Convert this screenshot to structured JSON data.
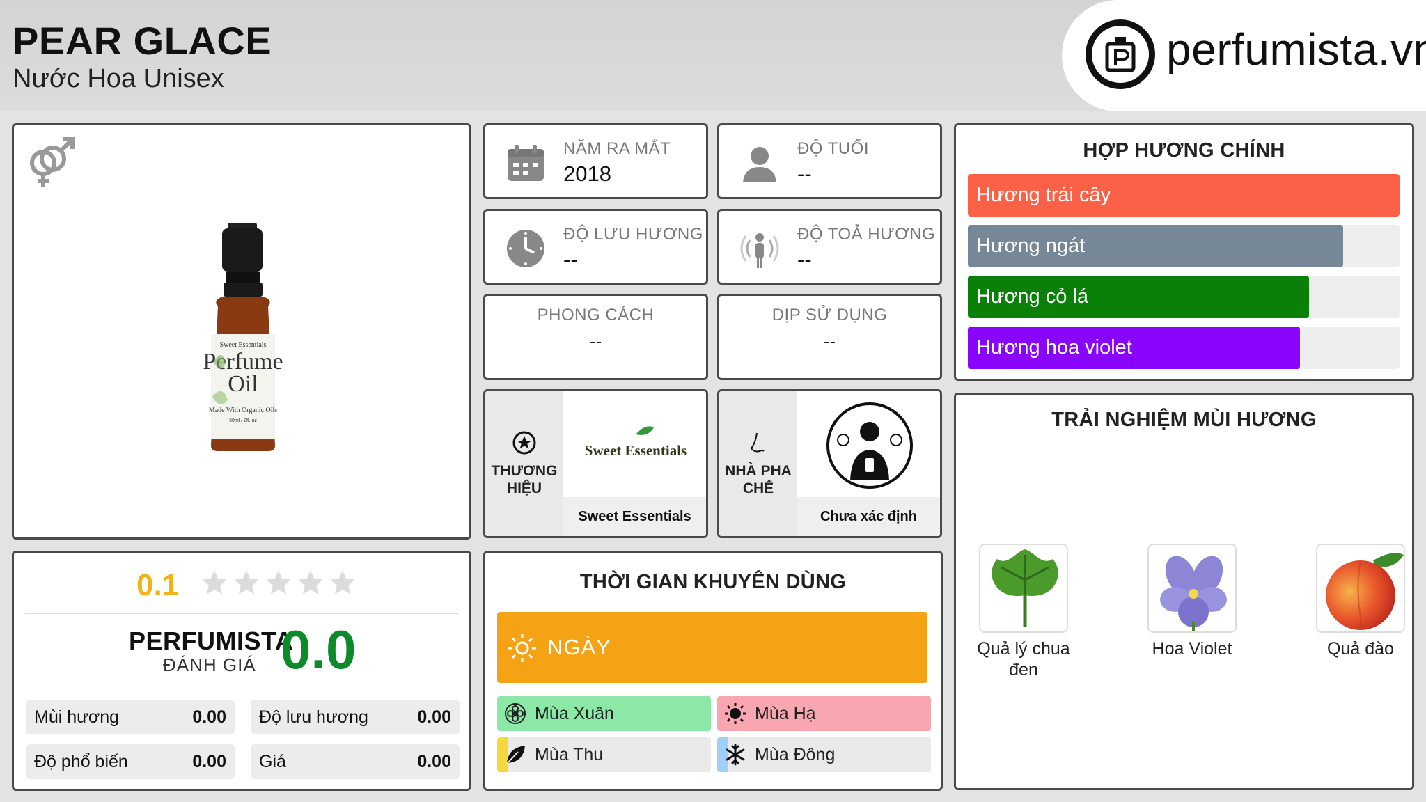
{
  "header": {
    "title": "PEAR GLACE",
    "subtitle": "Nước Hoa Unisex",
    "logo_text": "perfumista.vn"
  },
  "product": {
    "gender_icon": "unisex-gender-icon",
    "bottle_brand_text": "Sweet Essentials",
    "bottle_product_line1": "Perfume",
    "bottle_product_line2": "Oil",
    "bottle_note": "Made With Organic Oils",
    "bottle_size": "60ml / 2fl. oz"
  },
  "stats": {
    "release_year": {
      "label": "NĂM RA MẮT",
      "value": "2018",
      "icon": "calendar-icon"
    },
    "age": {
      "label": "ĐỘ TUỔI",
      "value": "--",
      "icon": "person-icon"
    },
    "longevity": {
      "label": "ĐỘ LƯU HƯƠNG",
      "value": "--",
      "icon": "clock-icon"
    },
    "sillage": {
      "label": "ĐỘ TOẢ HƯƠNG",
      "value": "--",
      "icon": "sillage-icon"
    },
    "style": {
      "label": "PHONG CÁCH",
      "value": "--"
    },
    "occasion": {
      "label": "DỊP SỬ DỤNG",
      "value": "--"
    }
  },
  "brand": {
    "label": "THƯƠNG HIỆU",
    "logo_text": "Sweet Essentials",
    "name": "Sweet Essentials",
    "icon": "star-circle-icon"
  },
  "perfumer": {
    "label": "NHÀ PHA CHẾ",
    "name": "Chưa xác định",
    "icon": "nose-icon"
  },
  "accords": {
    "title": "HỢP HƯƠNG CHÍNH",
    "items": [
      {
        "label": "Hương trái cây",
        "level": 1.0,
        "color": "#fa6147"
      },
      {
        "label": "Hương ngát",
        "level": 0.87,
        "color": "#768898"
      },
      {
        "label": "Hương cỏ lá",
        "level": 0.79,
        "color": "#0a8008"
      },
      {
        "label": "Hương hoa violet",
        "level": 0.77,
        "color": "#8a05fb"
      }
    ]
  },
  "notes": {
    "title": "TRẢI NGHIỆM MÙI HƯƠNG",
    "items": [
      {
        "label": "Quả lý chua đen",
        "icon": "blackcurrant-leaf-image"
      },
      {
        "label": "Hoa Violet",
        "icon": "violet-flower-image"
      },
      {
        "label": "Quả đào",
        "icon": "peach-image"
      }
    ]
  },
  "rating": {
    "value": "0.1",
    "stars_filled": 0.02,
    "stars_total": 5,
    "perfumista_label": "PERFUMISTA",
    "perfumista_sub": "ĐÁNH GIÁ",
    "perfumista_score": "0.0",
    "metrics": [
      {
        "label": "Mùi hương",
        "value": "0.00"
      },
      {
        "label": "Độ lưu hương",
        "value": "0.00"
      },
      {
        "label": "Độ phổ biến",
        "value": "0.00"
      },
      {
        "label": "Giá",
        "value": "0.00"
      }
    ]
  },
  "recommended_time": {
    "title": "THỜI GIAN KHUYÊN DÙNG",
    "day": {
      "label": "NGÀY",
      "level": 1.0,
      "color": "#f5a314"
    },
    "seasons": [
      {
        "label": "Mùa Xuân",
        "level": 1.0,
        "color": "#8be8a6",
        "icon": "flower-icon"
      },
      {
        "label": "Mùa Hạ",
        "level": 1.0,
        "color": "#f8a6b0",
        "icon": "sun-icon"
      },
      {
        "label": "Mùa Thu",
        "level": 0.05,
        "color": "#f5d83a",
        "icon": "leaf-icon"
      },
      {
        "label": "Mùa Đông",
        "level": 0.05,
        "color": "#9fd0f5",
        "icon": "snowflake-icon"
      }
    ]
  }
}
